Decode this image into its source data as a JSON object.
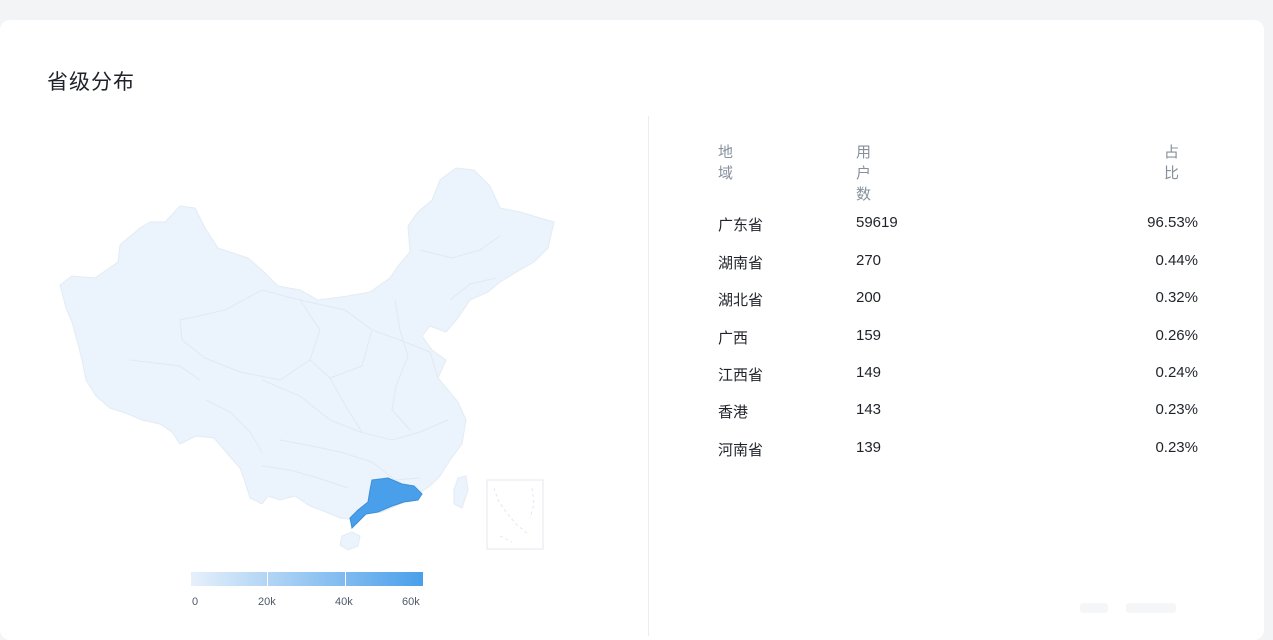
{
  "card": {
    "title": "省级分布"
  },
  "table": {
    "headers": {
      "region": "地域",
      "users": "用户数",
      "share": "占比"
    },
    "rows": [
      {
        "region": "广东省",
        "users": "59619",
        "share": "96.53%"
      },
      {
        "region": "湖南省",
        "users": "270",
        "share": "0.44%"
      },
      {
        "region": "湖北省",
        "users": "200",
        "share": "0.32%"
      },
      {
        "region": "广西",
        "users": "159",
        "share": "0.26%"
      },
      {
        "region": "江西省",
        "users": "149",
        "share": "0.24%"
      },
      {
        "region": "香港",
        "users": "143",
        "share": "0.23%"
      },
      {
        "region": "河南省",
        "users": "139",
        "share": "0.23%"
      }
    ]
  },
  "chart_data": {
    "type": "map",
    "regions": [
      "广东省",
      "湖南省",
      "湖北省",
      "广西",
      "江西省",
      "香港",
      "河南省"
    ],
    "values": [
      59619,
      270,
      200,
      159,
      149,
      143,
      139
    ],
    "visual_map": {
      "min": 0,
      "max": 60000,
      "ticks": [
        "0",
        "20k",
        "40k",
        "60k"
      ]
    },
    "colors": {
      "base": "#ebf3fc",
      "highlight": "#4a9fea",
      "legend_light": "#e6f0fb",
      "legend_dark": "#4a9fea"
    }
  }
}
